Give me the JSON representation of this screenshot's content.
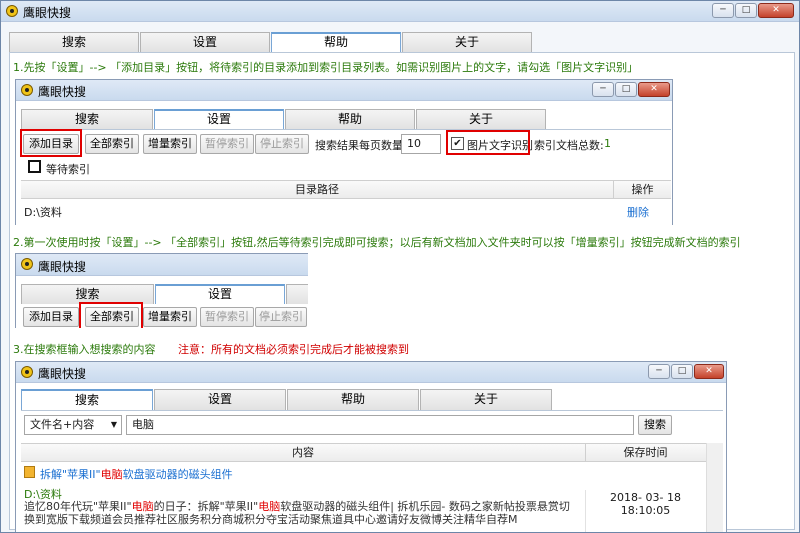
{
  "app": {
    "title": "鹰眼快搜",
    "btn_min": "─",
    "btn_max": "□",
    "btn_close": "✕"
  },
  "tabs": [
    "搜索",
    "设置",
    "帮助",
    "关于"
  ],
  "notes": {
    "step1": "1.先按「设置」--> 「添加目录」按钮，将待索引的目录添加到索引目录列表。如需识别图片上的文字，请勾选「图片文字识别」",
    "step2": "2.第一次使用时按「设置」--> 「全部索引」按钮,然后等待索引完成即可搜索；以后有新文档加入文件夹时可以按「增量索引」按钮完成新文档的索引",
    "step3": "3.在搜索框输入想搜索的内容",
    "step3_warn": "注意：所有的文档必须索引完成后才能被搜索到"
  },
  "settings": {
    "add_dir": "添加目录",
    "full_index": "全部索引",
    "incr_index": "增量索引",
    "pause_index": "暂停索引",
    "stop_index": "停止索引",
    "per_page_label": "搜索结果每页数量:",
    "per_page_value": "10",
    "ocr_label": "图片文字识别",
    "ocr_checked": "✔",
    "doc_total_label": "索引文档总数:",
    "doc_total_value": "1",
    "wait_label": "等待索引",
    "col_path": "目录路径",
    "col_op": "操作",
    "row_path": "D:\\资料",
    "row_delete": "删除"
  },
  "search": {
    "scope": "文件名+内容",
    "scope_arrow": "▼",
    "query": "电脑",
    "button": "搜索",
    "col_content": "内容",
    "col_time": "保存时间",
    "result": {
      "title_pre": "拆解\"苹果II\"",
      "title_hit": "电脑",
      "title_post": "软盘驱动器的磁头组件",
      "path": "D:\\资料",
      "snippet_a": "追忆80年代玩\"苹果II\"",
      "snippet_hit1": "电脑",
      "snippet_b": "的日子：拆解\"苹果II\"",
      "snippet_hit2": "电脑",
      "snippet_c": "软盘驱动器的磁头组件| 拆机乐园- 数码之家新帖投票悬赏切换到宽版下载频道会员推荐社区服务积分商城积分夺宝活动聚焦道具中心邀请好友微博关注精华自荐M",
      "time": "2018- 03- 18 18:10:05"
    }
  }
}
